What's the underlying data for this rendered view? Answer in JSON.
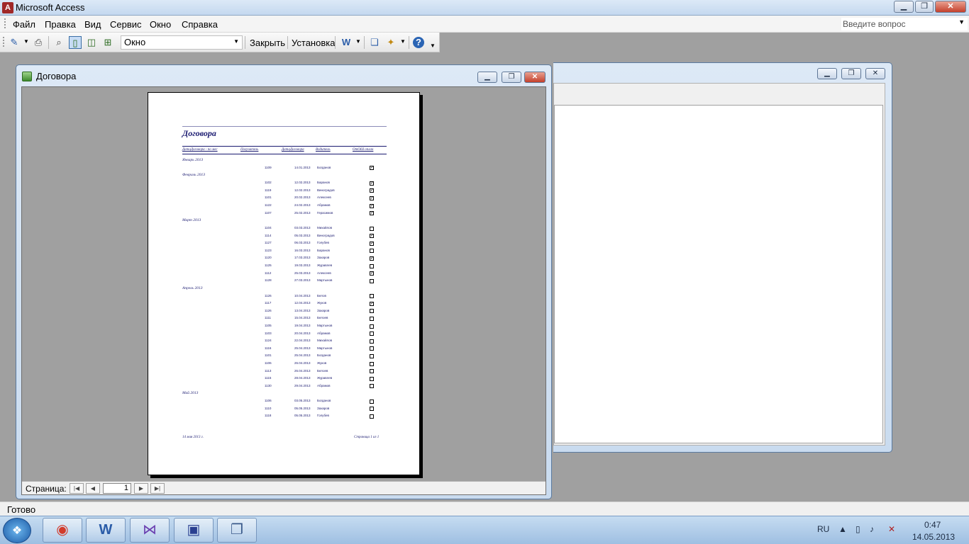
{
  "app": {
    "title": "Microsoft Access",
    "icon": "access-icon"
  },
  "titlebar_buttons": {
    "minimize": "▁",
    "maximize": "❐",
    "close": "✕"
  },
  "menu": {
    "items": [
      "Файл",
      "Правка",
      "Вид",
      "Сервис",
      "Окно",
      "Справка"
    ],
    "help_placeholder": "Введите вопрос"
  },
  "toolbar": {
    "zoom_value": "Окно",
    "close_label": "Закрыть",
    "setup_label": "Установка",
    "icons": [
      "design-view-icon",
      "print-icon",
      "zoom-icon",
      "one-page-icon",
      "two-pages-icon",
      "multiple-pages-icon",
      "word-export-icon",
      "database-window-icon",
      "new-object-icon",
      "help-icon"
    ]
  },
  "window": {
    "title": "Договора",
    "nav_label": "Страница:",
    "page": "1"
  },
  "report": {
    "title": "Договора",
    "headers": [
      "ДатаДоговора - по мес",
      "Получатель",
      "ДатаДоговора",
      "Водитель",
      "ОтОШ оплач"
    ],
    "footer_left": "14 мая 2013 г.",
    "footer_right": "Страница 1 из 1",
    "groups": [
      {
        "month": "Январь 2013",
        "rows": [
          {
            "num": "1109",
            "date": "14.01.2013",
            "name": "Богданов",
            "paid": true
          }
        ]
      },
      {
        "month": "Февраль 2013",
        "rows": [
          {
            "num": "1102",
            "date": "12.02.2013",
            "name": "Баранов",
            "paid": true
          },
          {
            "num": "1119",
            "date": "12.02.2013",
            "name": "Виноградов",
            "paid": true
          },
          {
            "num": "1101",
            "date": "20.02.2013",
            "name": "Алексеев",
            "paid": true
          },
          {
            "num": "1122",
            "date": "24.02.2013",
            "name": "Абрамов",
            "paid": true
          },
          {
            "num": "1107",
            "date": "25.02.2013",
            "name": "Герасимов",
            "paid": true
          }
        ]
      },
      {
        "month": "Март 2013",
        "rows": [
          {
            "num": "1104",
            "date": "03.03.2013",
            "name": "Михайлов",
            "paid": false
          },
          {
            "num": "1114",
            "date": "05.03.2013",
            "name": "Виноградов",
            "paid": true
          },
          {
            "num": "1127",
            "date": "06.03.2013",
            "name": "Голубев",
            "paid": true
          },
          {
            "num": "1123",
            "date": "16.03.2013",
            "name": "Баранов",
            "paid": false
          },
          {
            "num": "1120",
            "date": "17.03.2013",
            "name": "Захаров",
            "paid": true
          },
          {
            "num": "1125",
            "date": "19.03.2013",
            "name": "Журавлев",
            "paid": false
          },
          {
            "num": "1112",
            "date": "25.03.2013",
            "name": "Алексеев",
            "paid": true
          },
          {
            "num": "1128",
            "date": "27.03.2013",
            "name": "Мартынов",
            "paid": false
          }
        ]
      },
      {
        "month": "Апрель 2013",
        "rows": [
          {
            "num": "1126",
            "date": "10.04.2013",
            "name": "Белов",
            "paid": false
          },
          {
            "num": "1117",
            "date": "12.04.2013",
            "name": "Жуков",
            "paid": true
          },
          {
            "num": "1126",
            "date": "13.04.2013",
            "name": "Захаров",
            "paid": false
          },
          {
            "num": "1111",
            "date": "15.04.2013",
            "name": "Белоев",
            "paid": false
          },
          {
            "num": "1105",
            "date": "19.04.2013",
            "name": "Мартынов",
            "paid": false
          },
          {
            "num": "1103",
            "date": "20.04.2013",
            "name": "Абрамов",
            "paid": false
          },
          {
            "num": "1124",
            "date": "22.04.2013",
            "name": "Михайлов",
            "paid": false
          },
          {
            "num": "1116",
            "date": "25.04.2013",
            "name": "Мартынов",
            "paid": false
          },
          {
            "num": "1101",
            "date": "25.04.2013",
            "name": "Богданов",
            "paid": false
          },
          {
            "num": "1106",
            "date": "26.04.2013",
            "name": "Жуков",
            "paid": false
          },
          {
            "num": "1113",
            "date": "26.04.2013",
            "name": "Белоев",
            "paid": false
          },
          {
            "num": "1115",
            "date": "28.04.2013",
            "name": "Журавлев",
            "paid": false
          },
          {
            "num": "1130",
            "date": "29.04.2013",
            "name": "Абрамов",
            "paid": false
          }
        ]
      },
      {
        "month": "Май 2013",
        "rows": [
          {
            "num": "1106",
            "date": "03.05.2013",
            "name": "Богданов",
            "paid": false
          },
          {
            "num": "1110",
            "date": "05.05.2013",
            "name": "Захаров",
            "paid": false
          },
          {
            "num": "1118",
            "date": "05.05.2013",
            "name": "Голубев",
            "paid": false
          }
        ]
      }
    ]
  },
  "status": {
    "text": "Готово"
  },
  "taskbar": {
    "apps": [
      "chrome-icon",
      "word-icon",
      "visual-studio-icon",
      "save-icon",
      "windows-icon"
    ],
    "lang": "RU",
    "time": "0:47",
    "date": "14.05.2013"
  }
}
